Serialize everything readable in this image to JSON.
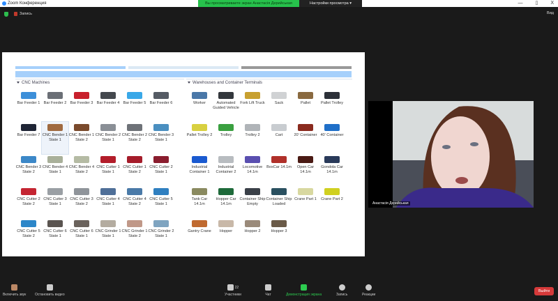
{
  "window": {
    "title": "Zoom Конференция",
    "banner": "Вы просматриваете экран Анастасія Дерийськая",
    "view_options": "Настройки просмотра ▾",
    "minimize": "—",
    "restore": "▯",
    "close": "X"
  },
  "topbar": {
    "recording": "Запись",
    "view": "Вид"
  },
  "left_panel": {
    "title": "CNC Machines",
    "items": [
      {
        "label": "Bar Feeder 1",
        "color": "#3d8fd9"
      },
      {
        "label": "Bar Feeder 2",
        "color": "#6b6f76"
      },
      {
        "label": "Bar Feeder 3",
        "color": "#c8202c"
      },
      {
        "label": "Bar Feeder 4",
        "color": "#44484e"
      },
      {
        "label": "Bar Feeder 5",
        "color": "#39a8e8"
      },
      {
        "label": "Bar Feeder 6",
        "color": "#555b64"
      },
      {
        "label": "Bar Feeder 7",
        "color": "#1f2535"
      },
      {
        "label": "CNC Bender 1 State 1",
        "color": "#a06a40"
      },
      {
        "label": "CNC Bender 1 State 2",
        "color": "#7a4a2c"
      },
      {
        "label": "CNC Bender 2 State 1",
        "color": "#8a8f96"
      },
      {
        "label": "CNC Bender 2 State 2",
        "color": "#6e7278"
      },
      {
        "label": "CNC Bender 3 State 1",
        "color": "#4a8fc0"
      },
      {
        "label": "CNC Bender 3 State 2",
        "color": "#3c88c8"
      },
      {
        "label": "CNC Bender 4 State 1",
        "color": "#a9b09a"
      },
      {
        "label": "CNC Bender 4 State 2",
        "color": "#b5bba4"
      },
      {
        "label": "CNC Cutter 1 State 1",
        "color": "#b31d2a"
      },
      {
        "label": "CNC Cutter 1 State 2",
        "color": "#a51c2a"
      },
      {
        "label": "CNC Cutter 2 State 1",
        "color": "#8a1d2e"
      },
      {
        "label": "CNC Cutter 2 State 2",
        "color": "#c42532"
      },
      {
        "label": "CNC Cutter 3 State 1",
        "color": "#9a9fa4"
      },
      {
        "label": "CNC Cutter 3 State 2",
        "color": "#8f949a"
      },
      {
        "label": "CNC Cutter 4 State 1",
        "color": "#4f6f98"
      },
      {
        "label": "CNC Cutter 4 State 2",
        "color": "#4a7aa8"
      },
      {
        "label": "CNC Cutter 5 State 1",
        "color": "#2f7fc0"
      },
      {
        "label": "CNC Cutter 5 State 2",
        "color": "#2c86c8"
      },
      {
        "label": "CNC Cutter 6 State 1",
        "color": "#5a5450"
      },
      {
        "label": "CNC Cutter 6 State 1",
        "color": "#6a625c"
      },
      {
        "label": "CNC Grinder 1 State 1",
        "color": "#b4aca0"
      },
      {
        "label": "CNC Grinder 1 State 2",
        "color": "#c09888"
      },
      {
        "label": "CNC Grinder 2 State 1",
        "color": "#7fa4c0"
      }
    ]
  },
  "right_panel": {
    "title": "Warehouses and Container Terminals",
    "items": [
      {
        "label": "Worker",
        "color": "#4a78a8"
      },
      {
        "label": "Automated Guided Vehicle",
        "color": "#33373c"
      },
      {
        "label": "Fork Lift Truck",
        "color": "#c8a030"
      },
      {
        "label": "Sack",
        "color": "#d0d2d4"
      },
      {
        "label": "Pallet",
        "color": "#8a6a40"
      },
      {
        "label": "Pallet Trolley",
        "color": "#2c3038"
      },
      {
        "label": "Pallet Trolley 2",
        "color": "#d8d040"
      },
      {
        "label": "Trolley",
        "color": "#3aa040"
      },
      {
        "label": "Trolley 2",
        "color": "#b0b4b8"
      },
      {
        "label": "Cart",
        "color": "#c8ccd0"
      },
      {
        "label": "20' Container",
        "color": "#8a2a1e"
      },
      {
        "label": "40' Container",
        "color": "#1f6fc8"
      },
      {
        "label": "Industrial Container 1",
        "color": "#1a5ad0"
      },
      {
        "label": "Industrial Container 2",
        "color": "#b8bcc0"
      },
      {
        "label": "Locomotive 14.1m",
        "color": "#5a4fb0"
      },
      {
        "label": "BoxCar 14.1m",
        "color": "#b0302a"
      },
      {
        "label": "Open Car 14.1m",
        "color": "#4a1a14"
      },
      {
        "label": "Gondola Car 14.1m",
        "color": "#2a3a5a"
      },
      {
        "label": "Tank Car 14.1m",
        "color": "#8a8a60"
      },
      {
        "label": "Hopper Car 14.1m",
        "color": "#1e6a3a"
      },
      {
        "label": "Container Ship Empty",
        "color": "#3a4048"
      },
      {
        "label": "Container Ship Loaded",
        "color": "#2a5060"
      },
      {
        "label": "Crane Part 1",
        "color": "#d8d8a0"
      },
      {
        "label": "Crane Part 2",
        "color": "#d0d020"
      },
      {
        "label": "Gantry Crane",
        "color": "#c06a30"
      },
      {
        "label": "Hopper",
        "color": "#c8b8a8"
      },
      {
        "label": "Hopper 2",
        "color": "#9a8a7a"
      },
      {
        "label": "Hopper 3",
        "color": "#6a5a48"
      }
    ]
  },
  "video": {
    "name": "Анастасія Дерийськая"
  },
  "toolbar": {
    "unmute": "Включить звук",
    "start_video": "Остановить видео",
    "participants": "Участники",
    "participants_count": "22",
    "chat": "Чат",
    "share": "Демонстрация экрана",
    "record": "Запись",
    "reactions": "Реакции",
    "leave": "Выйти"
  }
}
